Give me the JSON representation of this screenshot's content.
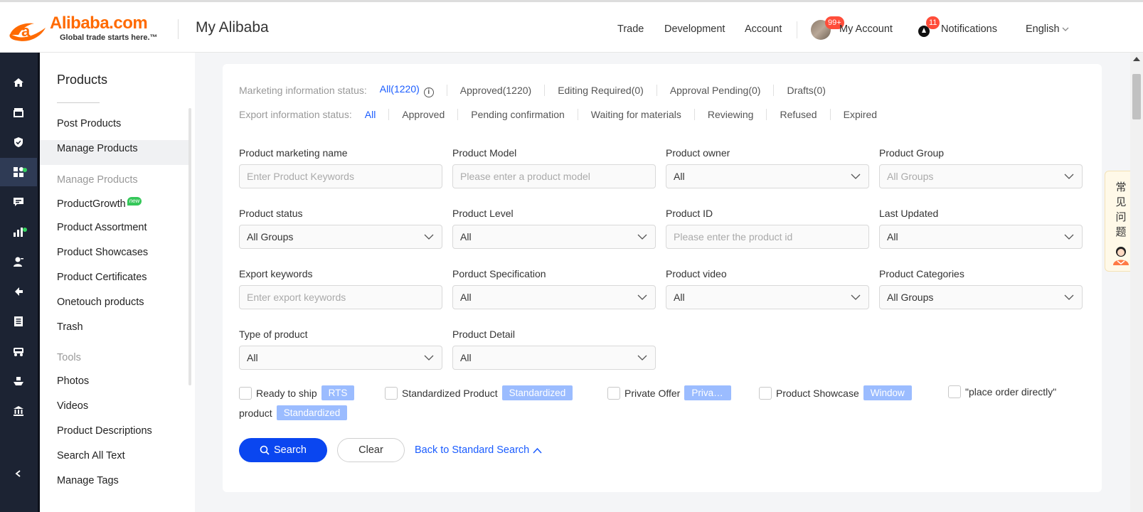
{
  "header": {
    "logo_text": "Alibaba.com",
    "logo_tagline": "Global trade starts here.™",
    "app_title": "My Alibaba",
    "nav": [
      "Trade",
      "Development",
      "Account"
    ],
    "account_label": "My Account",
    "account_badge": "99+",
    "notifications_label": "Notifications",
    "notifications_badge": "11",
    "language": "English"
  },
  "rail_icons": [
    "home-icon",
    "store-icon",
    "shield-icon",
    "products-icon",
    "chat-icon",
    "analytics-icon",
    "buyers-icon",
    "export-icon",
    "orders-icon",
    "logistics-icon",
    "ship-icon",
    "finance-icon",
    "collapse-icon"
  ],
  "sidebar": {
    "title": "Products",
    "top_items": [
      "Post Products",
      "Manage Products"
    ],
    "group_manage": "Manage Products",
    "manage_items": [
      "ProductGrowth",
      "Product Assortment",
      "Product Showcases",
      "Product Certificates",
      "Onetouch products",
      "Trash"
    ],
    "new_tag": "new",
    "group_tools": "Tools",
    "tools_items": [
      "Photos",
      "Videos",
      "Product Descriptions",
      "Search All Text",
      "Manage Tags"
    ]
  },
  "marketing_status": {
    "label": "Marketing information status:",
    "options": [
      "All(1220)",
      "Approved(1220)",
      "Editing Required(0)",
      "Approval Pending(0)",
      "Drafts(0)"
    ]
  },
  "export_status": {
    "label": "Export information status:",
    "options": [
      "All",
      "Approved",
      "Pending confirmation",
      "Waiting for materials",
      "Reviewing",
      "Refused",
      "Expired"
    ]
  },
  "filters": [
    {
      "label": "Product marketing name",
      "kind": "input",
      "placeholder": "Enter Product Keywords"
    },
    {
      "label": "Product Model",
      "kind": "input",
      "placeholder": "Please enter a product model"
    },
    {
      "label": "Product owner",
      "kind": "select",
      "value": "All"
    },
    {
      "label": "Product Group",
      "kind": "select",
      "value": "All Groups",
      "dim": true
    },
    {
      "label": "Product status",
      "kind": "select",
      "value": "All Groups"
    },
    {
      "label": "Product Level",
      "kind": "select",
      "value": "All"
    },
    {
      "label": "Product ID",
      "kind": "input",
      "placeholder": "Please enter the product id"
    },
    {
      "label": "Last Updated",
      "kind": "select",
      "value": "All"
    },
    {
      "label": "Export keywords",
      "kind": "input",
      "placeholder": "Enter export keywords"
    },
    {
      "label": "Porduct Specification",
      "kind": "select",
      "value": "All"
    },
    {
      "label": "Product video",
      "kind": "select",
      "value": "All"
    },
    {
      "label": "Product Categories",
      "kind": "select",
      "value": "All Groups"
    },
    {
      "label": "Type of product",
      "kind": "select",
      "value": "All"
    },
    {
      "label": "Product Detail",
      "kind": "select",
      "value": "All"
    }
  ],
  "checkboxes": [
    {
      "label": "Ready to ship",
      "tag": "RTS"
    },
    {
      "label": "Standardized Product",
      "tag": "Standardized"
    },
    {
      "label": "Private Offer",
      "tag": "Private Offer"
    },
    {
      "label": "Product Showcase",
      "tag": "Window"
    },
    {
      "label": "\"place order directly\"",
      "tag": ""
    }
  ],
  "checkbox_wrap": {
    "text": "product",
    "tag": "Standardized"
  },
  "actions": {
    "search": "Search",
    "clear": "Clear",
    "back": "Back to Standard Search"
  },
  "faq_text": "常见问题",
  "colors": {
    "brand": "#ff6a00",
    "primary": "#0a46f0",
    "link": "#1a5cff",
    "rail": "#1c2333",
    "tag": "#9bbcff",
    "badge": "#ff4d3a"
  }
}
